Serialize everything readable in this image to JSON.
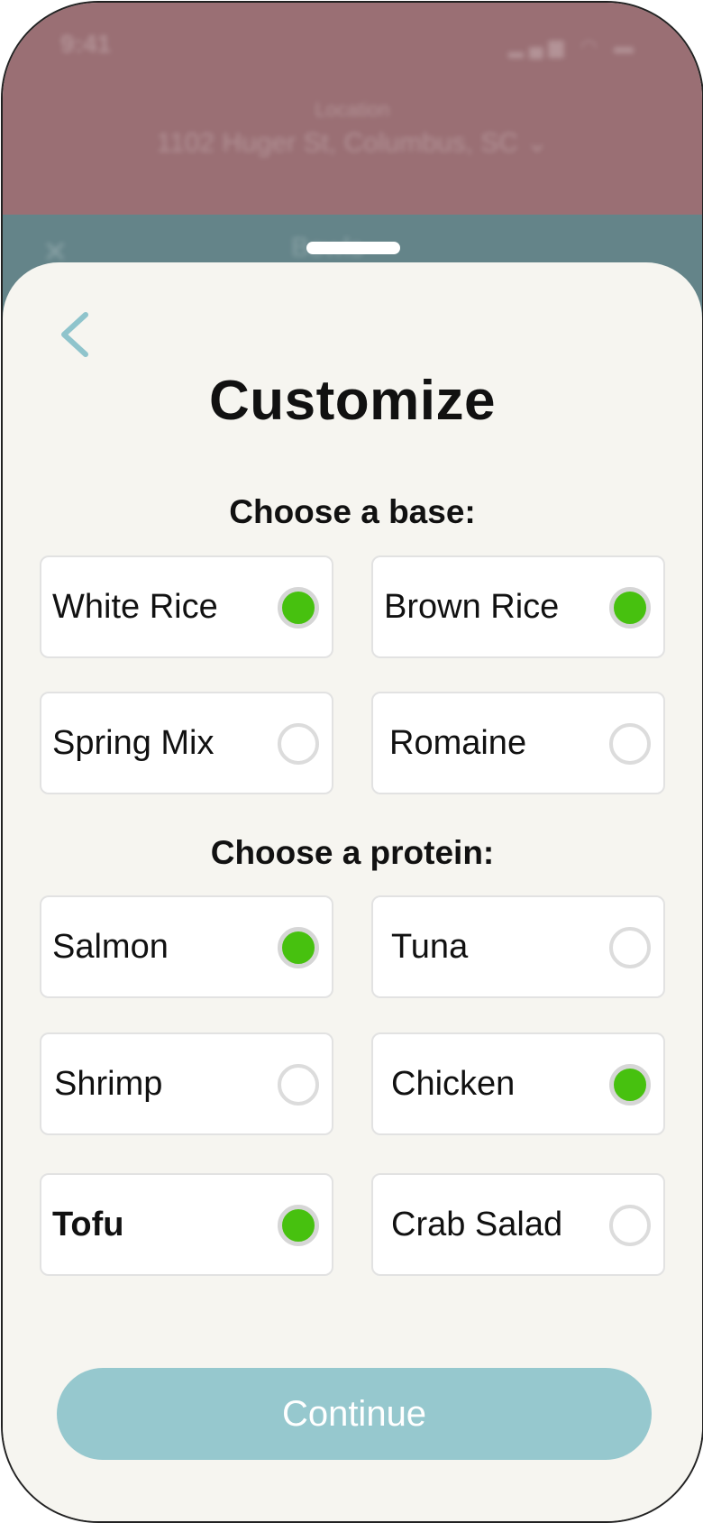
{
  "background": {
    "status_time": "9:41",
    "status_icons": "▂▄▆ ◠ ▬",
    "location_label": "Location",
    "location_value": "1102 Huger St, Columbus, SC ⌄",
    "left_icon": "✕",
    "middle_text": "Bowls"
  },
  "sheet": {
    "title": "Customize",
    "back_icon": "chevron-left-icon"
  },
  "base_section": {
    "title": "Choose a base:",
    "options": [
      {
        "label": "White Rice",
        "selected": true
      },
      {
        "label": "Brown Rice",
        "selected": true
      },
      {
        "label": "Spring Mix",
        "selected": false
      },
      {
        "label": "Romaine",
        "selected": false
      }
    ]
  },
  "protein_section": {
    "title": "Choose a protein:",
    "options": [
      {
        "label": "Salmon",
        "selected": true
      },
      {
        "label": "Tuna",
        "selected": false
      },
      {
        "label": "Shrimp",
        "selected": false
      },
      {
        "label": "Chicken",
        "selected": true
      },
      {
        "label": "Tofu",
        "selected": true
      },
      {
        "label": "Crab Salad",
        "selected": false
      }
    ]
  },
  "continue_label": "Continue",
  "colors": {
    "accent_teal": "#96c8ce",
    "selected_green": "#47c10f",
    "sheet_bg": "#f6f5f0"
  }
}
